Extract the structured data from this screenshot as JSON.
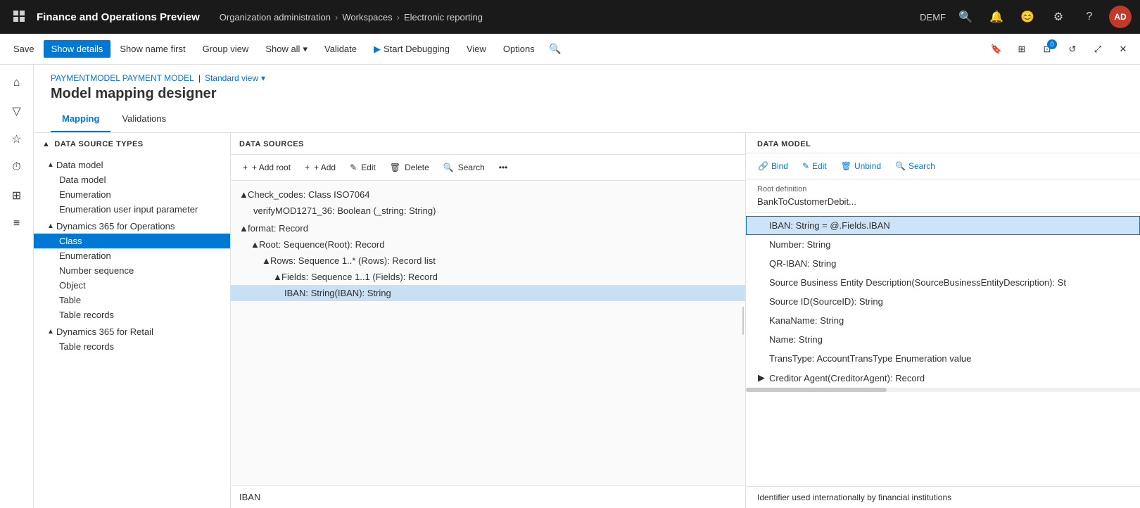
{
  "app": {
    "title": "Finance and Operations Preview",
    "breadcrumb": [
      "Organization administration",
      "Workspaces",
      "Electronic reporting"
    ],
    "env": "DEMF",
    "user_initials": "AD"
  },
  "toolbar": {
    "save_label": "Save",
    "show_details_label": "Show details",
    "show_name_first_label": "Show name first",
    "group_view_label": "Group view",
    "show_all_label": "Show all",
    "validate_label": "Validate",
    "start_debugging_label": "Start Debugging",
    "view_label": "View",
    "options_label": "Options"
  },
  "page": {
    "breadcrumb_part1": "PAYMENTMODEL PAYMENT MODEL",
    "breadcrumb_sep": "|",
    "breadcrumb_view": "Standard view",
    "title": "Model mapping designer",
    "tabs": [
      "Mapping",
      "Validations"
    ]
  },
  "left_panel": {
    "header": "DATA SOURCE TYPES",
    "items": [
      {
        "label": "Data model",
        "indent": 0,
        "expandable": true,
        "expanded": true
      },
      {
        "label": "Data model",
        "indent": 1,
        "expandable": false
      },
      {
        "label": "Enumeration",
        "indent": 1,
        "expandable": false
      },
      {
        "label": "Enumeration user input parameter",
        "indent": 1,
        "expandable": false
      },
      {
        "label": "Dynamics 365 for Operations",
        "indent": 0,
        "expandable": true,
        "expanded": true
      },
      {
        "label": "Class",
        "indent": 1,
        "expandable": false,
        "selected": true
      },
      {
        "label": "Enumeration",
        "indent": 1,
        "expandable": false
      },
      {
        "label": "Number sequence",
        "indent": 1,
        "expandable": false
      },
      {
        "label": "Object",
        "indent": 1,
        "expandable": false
      },
      {
        "label": "Table",
        "indent": 1,
        "expandable": false
      },
      {
        "label": "Table records",
        "indent": 1,
        "expandable": false
      },
      {
        "label": "Dynamics 365 for Retail",
        "indent": 0,
        "expandable": true,
        "expanded": true
      },
      {
        "label": "Table records",
        "indent": 1,
        "expandable": false
      }
    ]
  },
  "middle_panel": {
    "header": "DATA SOURCES",
    "toolbar": {
      "add_root": "+ Add root",
      "add": "+ Add",
      "edit": "✎ Edit",
      "delete": "🗑 Delete",
      "search": "Search"
    },
    "items": [
      {
        "label": "Check_codes: Class ISO7064",
        "indent": 0,
        "expanded": true,
        "expandable": true
      },
      {
        "label": "verifyMOD1271_36: Boolean (_string: String)",
        "indent": 1,
        "expandable": false
      },
      {
        "label": "format: Record",
        "indent": 0,
        "expanded": true,
        "expandable": true
      },
      {
        "label": "Root: Sequence(Root): Record",
        "indent": 1,
        "expanded": true,
        "expandable": true
      },
      {
        "label": "Rows: Sequence 1..* (Rows): Record list",
        "indent": 2,
        "expanded": true,
        "expandable": true
      },
      {
        "label": "Fields: Sequence 1..1 (Fields): Record",
        "indent": 3,
        "expanded": true,
        "expandable": true
      },
      {
        "label": "IBAN: String(IBAN): String",
        "indent": 4,
        "expandable": false,
        "selected": true
      }
    ],
    "footer": "IBAN"
  },
  "right_panel": {
    "header": "DATA MODEL",
    "toolbar": {
      "bind": "Bind",
      "edit": "Edit",
      "unbind": "Unbind",
      "search": "Search"
    },
    "root_def_label": "Root definition",
    "root_def_value": "BankToCustomerDebit...",
    "items": [
      {
        "label": "IBAN: String = @.Fields.IBAN",
        "indent": 0,
        "selected": true
      },
      {
        "label": "Number: String",
        "indent": 0
      },
      {
        "label": "QR-IBAN: String",
        "indent": 0
      },
      {
        "label": "Source Business Entity Description(SourceBusinessEntityDescription): St",
        "indent": 0
      },
      {
        "label": "Source ID(SourceID): String",
        "indent": 0
      },
      {
        "label": "KanaName: String",
        "indent": 0
      },
      {
        "label": "Name: String",
        "indent": 0
      },
      {
        "label": "TransType: AccountTransType Enumeration value",
        "indent": 0
      },
      {
        "label": "Creditor Agent(CreditorAgent): Record",
        "indent": 0,
        "expandable": true
      }
    ],
    "footer": "Identifier used internationally by financial institutions"
  }
}
